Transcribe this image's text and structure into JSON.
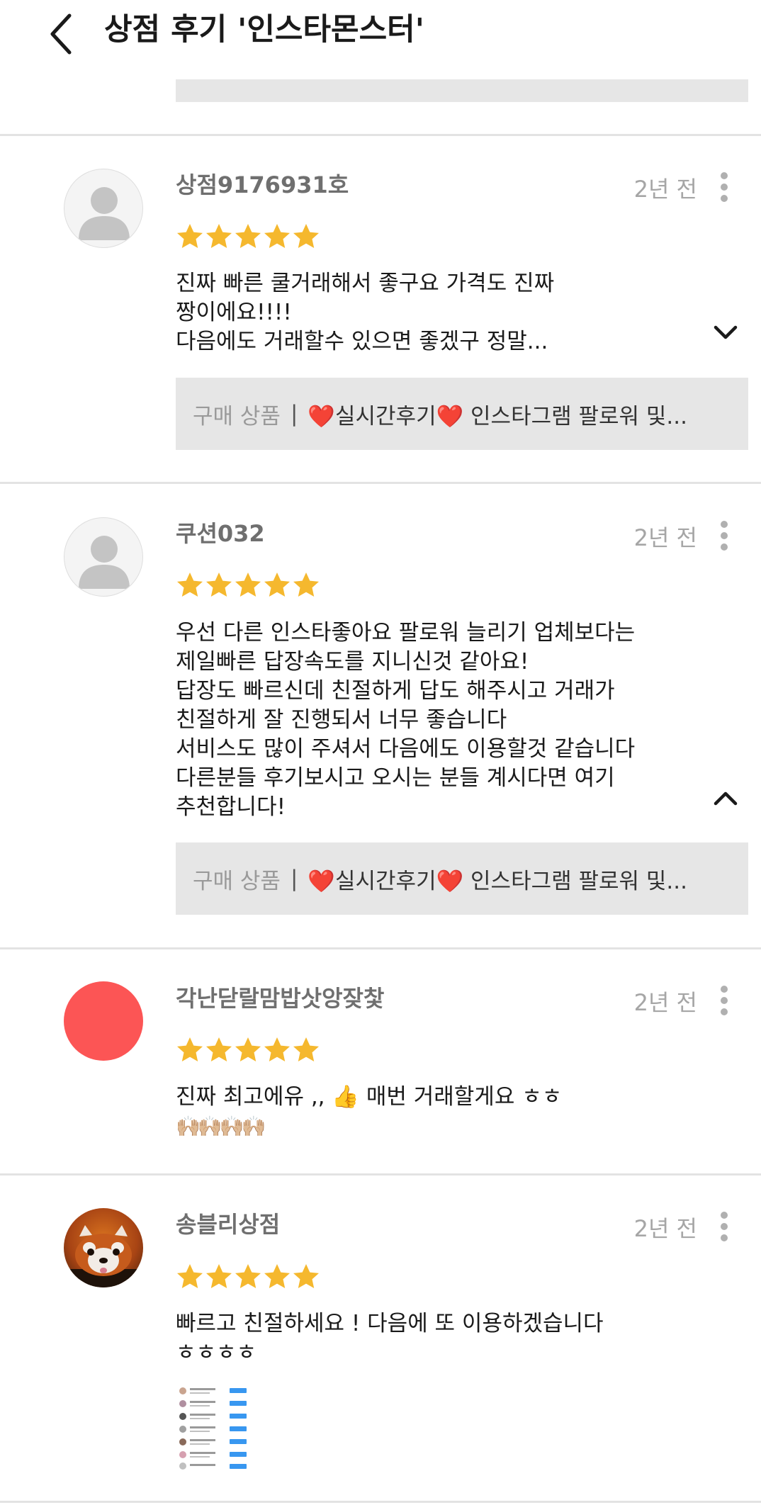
{
  "header": {
    "title": "상점 후기 '인스타몬스터'"
  },
  "colors": {
    "star": "#f5b82e",
    "avatar_red": "#fc5555",
    "divider": "#e3e3e3"
  },
  "reviews": [
    {
      "nickname": "상점9176931호",
      "time": "2년 전",
      "rating": 5,
      "avatar": "default-profile-icon",
      "text": "진짜 빠른 쿨거래해서 좋구요 가격도 진짜\n짱이에요!!!!\n다음에도 거래할수 있으면 좋겠구 정말...",
      "toggle": "expand",
      "product": {
        "label": "구매 상품",
        "name": "❤️실시간후기❤️ 인스타그램 팔로워 및..."
      }
    },
    {
      "nickname": "쿠션032",
      "time": "2년 전",
      "rating": 5,
      "avatar": "default-profile-icon",
      "text": "우선 다른 인스타좋아요 팔로워 늘리기 업체보다는\n제일빠른 답장속도를 지니신것 같아요!\n답장도 빠르신데 친절하게 답도 해주시고 거래가\n친절하게 잘 진행되서 너무 좋습니다\n서비스도 많이 주셔서 다음에도 이용할것 같습니다\n다른분들 후기보시고 오시는 분들 계시다면 여기\n추천합니다!",
      "toggle": "collapse",
      "product": {
        "label": "구매 상품",
        "name": "❤️실시간후기❤️ 인스타그램 팔로워 및..."
      }
    },
    {
      "nickname": "각난닫랄맘밥삿앙잦찿",
      "time": "2년 전",
      "rating": 5,
      "avatar": "red-circle-avatar",
      "text": "진짜 최고에유 ,, 👍 매번 거래할게요 ㅎㅎ",
      "emoji_line": "🙌🏼🙌🏼🙌🏼🙌🏼"
    },
    {
      "nickname": "송블리상점",
      "time": "2년 전",
      "rating": 5,
      "avatar": "red-panda-photo",
      "text": "빠르고 친절하세요 ! 다음에 또 이용하겠습니다\nㅎㅎㅎㅎ",
      "image": "follower-list-screenshot"
    }
  ]
}
